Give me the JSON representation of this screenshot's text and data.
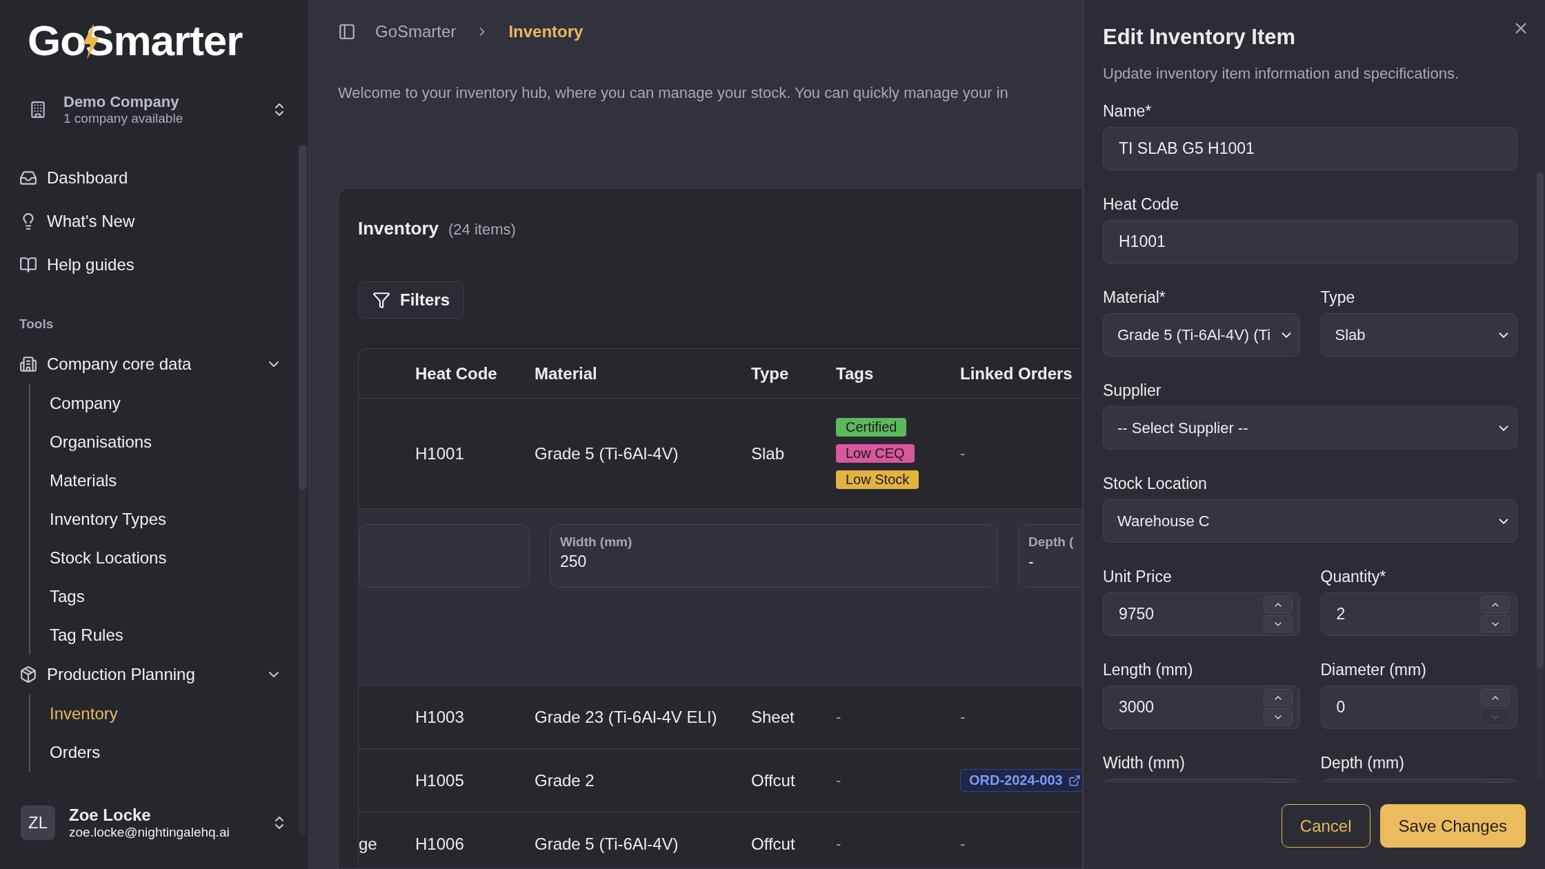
{
  "logo": "GoSmarter",
  "company": {
    "name": "Demo Company",
    "subtitle": "1 company available"
  },
  "nav": [
    {
      "label": "Dashboard"
    },
    {
      "label": "What's New"
    },
    {
      "label": "Help guides"
    }
  ],
  "tools_heading": "Tools",
  "groups": [
    {
      "label": "Company core data",
      "expanded": true,
      "children": [
        {
          "label": "Company",
          "selected": false
        },
        {
          "label": "Organisations",
          "selected": false
        },
        {
          "label": "Materials",
          "selected": false
        },
        {
          "label": "Inventory Types",
          "selected": false
        },
        {
          "label": "Stock Locations",
          "selected": false
        },
        {
          "label": "Tags",
          "selected": false
        },
        {
          "label": "Tag Rules",
          "selected": false
        }
      ]
    },
    {
      "label": "Production Planning",
      "expanded": true,
      "children": [
        {
          "label": "Inventory",
          "selected": true
        },
        {
          "label": "Orders",
          "selected": false
        }
      ]
    }
  ],
  "user": {
    "initials": "ZL",
    "name": "Zoe Locke",
    "email": "zoe.locke@nightingalehq.ai"
  },
  "breadcrumb": [
    {
      "label": "GoSmarter",
      "current": false
    },
    {
      "label": "Inventory",
      "current": true
    }
  ],
  "intro": "Welcome to your inventory hub, where you can manage your stock. You can quickly manage your in",
  "card": {
    "title": "Inventory",
    "count": "(24 items)",
    "filters_button": "Filters"
  },
  "table": {
    "columns": [
      "Heat Code",
      "Material",
      "Type",
      "Tags",
      "Linked Orders"
    ],
    "rows": [
      {
        "heat_code": "H1001",
        "material": "Grade 5 (Ti-6Al-4V)",
        "type": "Slab",
        "tags": [
          {
            "label": "Certified",
            "color": "#5cb85c"
          },
          {
            "label": "Low CEQ",
            "color": "#d9579b"
          },
          {
            "label": "Low Stock",
            "color": "#e3b341"
          }
        ],
        "linked": {
          "kind": "text",
          "text": "-"
        },
        "expanded": true,
        "details": [
          {
            "label": "Width (mm)",
            "value": "250"
          },
          {
            "label": "Depth (",
            "value": "-"
          }
        ]
      },
      {
        "heat_code": "H1003",
        "material": "Grade 23 (Ti-6Al-4V ELI)",
        "type": "Sheet",
        "tags_text": "-",
        "linked": {
          "kind": "text",
          "text": "-"
        },
        "expanded": false
      },
      {
        "heat_code": "H1005",
        "material": "Grade 2",
        "type": "Offcut",
        "tags_text": "-",
        "linked": {
          "kind": "link",
          "text": "ORD-2024-003"
        },
        "expanded": false
      },
      {
        "column_1": "ge",
        "heat_code": "H1006",
        "material": "Grade 5 (Ti-6Al-4V)",
        "type": "Offcut",
        "tags_text": "-",
        "linked": {
          "kind": "text",
          "text": "-"
        },
        "expanded": false
      }
    ]
  },
  "panel": {
    "title": "Edit Inventory Item",
    "subtitle": "Update inventory item information and specifications.",
    "rows": [
      [
        {
          "kind": "text",
          "label": "Name*",
          "value": "TI SLAB G5 H1001"
        }
      ],
      [
        {
          "kind": "text",
          "label": "Heat Code",
          "value": "H1001"
        }
      ],
      [
        {
          "kind": "select",
          "label": "Material*",
          "value": "Grade 5 (Ti-6Al-4V) (Ti"
        },
        {
          "kind": "select",
          "label": "Type",
          "value": "Slab"
        }
      ],
      [
        {
          "kind": "select",
          "label": "Supplier",
          "value": "-- Select Supplier --"
        }
      ],
      [
        {
          "kind": "select",
          "label": "Stock Location",
          "value": "Warehouse C"
        }
      ],
      [
        {
          "kind": "number",
          "label": "Unit Price",
          "value": "9750",
          "decrement_disabled": false
        },
        {
          "kind": "number",
          "label": "Quantity*",
          "value": "2",
          "decrement_disabled": false
        }
      ],
      [
        {
          "kind": "number",
          "label": "Length (mm)",
          "value": "3000",
          "decrement_disabled": false
        },
        {
          "kind": "number",
          "label": "Diameter (mm)",
          "value": "0",
          "decrement_disabled": true
        }
      ],
      [
        {
          "kind": "number",
          "label": "Width (mm)"
        },
        {
          "kind": "number",
          "label": "Depth (mm)"
        }
      ]
    ],
    "buttons": [
      {
        "label": "Cancel",
        "kind": "secondary"
      },
      {
        "label": "Save Changes",
        "kind": "primary"
      }
    ]
  }
}
